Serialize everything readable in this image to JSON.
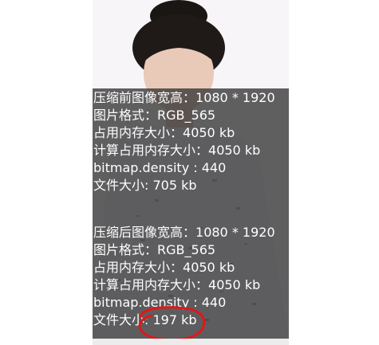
{
  "before": {
    "lines": [
      {
        "label": "压缩前图像宽高：",
        "value": "1080 * 1920"
      },
      {
        "label": "图片格式：",
        "value": "RGB_565"
      },
      {
        "label": "占用内存大小：",
        "value": "4050 kb"
      },
      {
        "label": "计算占用内存大小：",
        "value": "4050 kb"
      },
      {
        "label": "bitmap.density : ",
        "value": "440"
      },
      {
        "label": "文件大小: ",
        "value": "705 kb"
      }
    ]
  },
  "after": {
    "lines": [
      {
        "label": "压缩后图像宽高：",
        "value": "1080 * 1920"
      },
      {
        "label": "图片格式：",
        "value": "RGB_565"
      },
      {
        "label": "占用内存大小：",
        "value": "4050 kb"
      },
      {
        "label": "计算占用内存大小：",
        "value": "4050 kb"
      },
      {
        "label": "bitmap.density : ",
        "value": "440"
      },
      {
        "label": "文件大小: ",
        "value": "197 kb"
      }
    ]
  },
  "colors": {
    "overlay": "#343434",
    "text": "#ffffff",
    "annotation_circle": "#e01818"
  },
  "icons": {
    "annotation": "red-hand-drawn-circle"
  }
}
